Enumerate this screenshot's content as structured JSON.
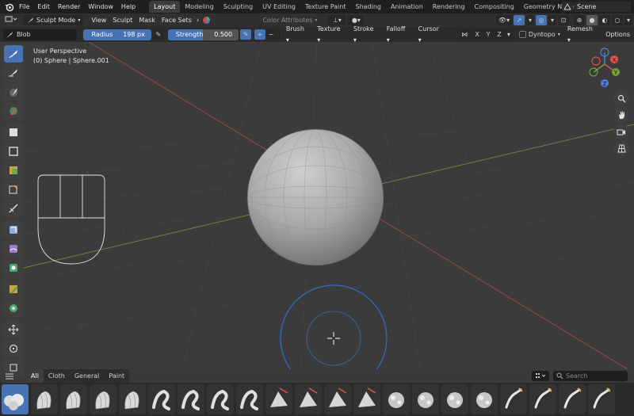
{
  "menubar": {
    "logo": "blender-logo-icon",
    "items": [
      "File",
      "Edit",
      "Render",
      "Window",
      "Help"
    ],
    "workspaces": [
      "Layout",
      "Modeling",
      "Sculpting",
      "UV Editing",
      "Texture Paint",
      "Shading",
      "Animation",
      "Rendering",
      "Compositing",
      "Geometry Nodes"
    ],
    "active_workspace": "Layout",
    "scene": "Scene"
  },
  "header": {
    "mode": "Sculpt Mode",
    "menus": [
      "View",
      "Sculpt",
      "Mask",
      "Face Sets"
    ],
    "color_attributes": "Color Attributes"
  },
  "tool_header": {
    "brush": "Blob",
    "radius_label": "Radius",
    "radius_value": "198 px",
    "strength_label": "Strength",
    "strength_value": "0.500",
    "strength_fraction": 0.5,
    "dropdowns": [
      "Brush",
      "Texture",
      "Stroke",
      "Falloff",
      "Cursor"
    ],
    "axes": [
      "X",
      "Y",
      "Z"
    ],
    "dyntopo": "Dyntopo",
    "remesh": "Remesh",
    "options": "Options"
  },
  "viewport": {
    "perspective": "User Perspective",
    "object": "(0) Sphere | Sphere.001",
    "gizmo_axes": [
      "X",
      "Y",
      "Z"
    ],
    "axis_colors": {
      "x": "#e2524f",
      "y": "#74a03a",
      "z": "#4f7fd8"
    }
  },
  "toolbar": {
    "tools": [
      "brush-draw-icon",
      "brush-smooth-icon",
      "brush-mask-icon",
      "brush-paint-icon",
      "box-mask-icon",
      "box-hide-icon",
      "box-face-set-icon",
      "box-trim-icon",
      "line-project-icon",
      "mesh-filter-icon",
      "cloth-filter-icon",
      "color-filter-icon",
      "edit-face-set-icon",
      "mask-by-color-icon",
      "move-icon",
      "rotate-icon",
      "scale-icon"
    ]
  },
  "shelf": {
    "tabs": [
      "All",
      "Cloth",
      "General",
      "Paint"
    ],
    "active_tab": "All",
    "search_placeholder": "Search",
    "brushes": [
      "blob",
      "clay",
      "clay-strips",
      "clay-thumb",
      "crease",
      "draw",
      "draw-sharp",
      "elastic-grab",
      "fill",
      "flatten",
      "grab",
      "inflate",
      "layer",
      "multires-displace",
      "nudge",
      "pinch",
      "plane",
      "rotate",
      "scrape",
      "smooth",
      "snake-hook"
    ]
  },
  "colors": {
    "accent": "#4772b3",
    "background": "#3b3b3b",
    "header": "#303030"
  }
}
